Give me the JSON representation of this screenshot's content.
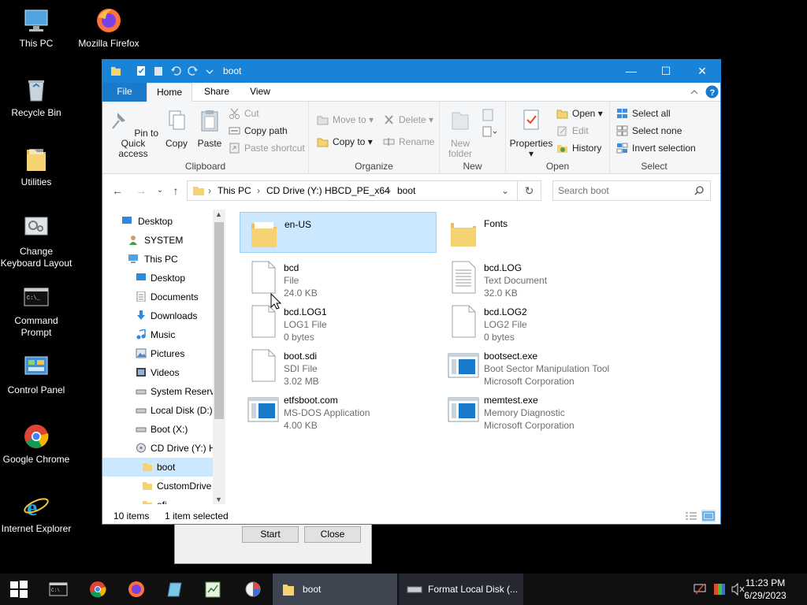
{
  "desktop": {
    "icons": [
      {
        "label": "This PC"
      },
      {
        "label": "Mozilla Firefox"
      },
      {
        "label": "Recycle Bin"
      },
      {
        "label": "Utilities"
      },
      {
        "label": "Change Keyboard Layout"
      },
      {
        "label": "Command Prompt"
      },
      {
        "label": "Control Panel"
      },
      {
        "label": "Google Chrome"
      },
      {
        "label": "Internet Explorer"
      }
    ]
  },
  "bg_dialog": {
    "start_label": "Start",
    "close_label": "Close"
  },
  "window": {
    "title": "boot",
    "controls": {
      "minimize": "—",
      "maximize": "☐",
      "close": "✕"
    },
    "ribbon_tabs": [
      "File",
      "Home",
      "Share",
      "View"
    ],
    "ribbon": {
      "clipboard": {
        "label": "Clipboard",
        "pin": "Pin to Quick access",
        "copy": "Copy",
        "paste": "Paste",
        "cut": "Cut",
        "copy_path": "Copy path",
        "paste_shortcut": "Paste shortcut"
      },
      "organize": {
        "label": "Organize",
        "move_to": "Move to",
        "copy_to": "Copy to",
        "delete": "Delete",
        "rename": "Rename"
      },
      "new": {
        "label": "New",
        "new_folder": "New folder"
      },
      "open": {
        "label": "Open",
        "properties": "Properties",
        "open": "Open",
        "edit": "Edit",
        "history": "History"
      },
      "select": {
        "label": "Select",
        "select_all": "Select all",
        "select_none": "Select none",
        "invert": "Invert selection"
      }
    },
    "address": {
      "crumbs": [
        "This PC",
        "CD Drive (Y:) HBCD_PE_x64",
        "boot"
      ],
      "search_placeholder": "Search boot"
    },
    "nav_items": [
      {
        "label": "Desktop"
      },
      {
        "label": "SYSTEM"
      },
      {
        "label": "This PC"
      },
      {
        "label": "Desktop"
      },
      {
        "label": "Documents"
      },
      {
        "label": "Downloads"
      },
      {
        "label": "Music"
      },
      {
        "label": "Pictures"
      },
      {
        "label": "Videos"
      },
      {
        "label": "System Reserve"
      },
      {
        "label": "Local Disk (D:)"
      },
      {
        "label": "Boot (X:)"
      },
      {
        "label": "CD Drive (Y:) H"
      },
      {
        "label": "boot"
      },
      {
        "label": "CustomDrive"
      },
      {
        "label": "efi"
      }
    ],
    "files": [
      {
        "name": "en-US",
        "l2": "",
        "l3": ""
      },
      {
        "name": "Fonts",
        "l2": "",
        "l3": ""
      },
      {
        "name": "bcd",
        "l2": "File",
        "l3": "24.0 KB"
      },
      {
        "name": "bcd.LOG",
        "l2": "Text Document",
        "l3": "32.0 KB"
      },
      {
        "name": "bcd.LOG1",
        "l2": "LOG1 File",
        "l3": "0 bytes"
      },
      {
        "name": "bcd.LOG2",
        "l2": "LOG2 File",
        "l3": "0 bytes"
      },
      {
        "name": "boot.sdi",
        "l2": "SDI File",
        "l3": "3.02 MB"
      },
      {
        "name": "bootsect.exe",
        "l2": "Boot Sector Manipulation Tool",
        "l3": "Microsoft Corporation"
      },
      {
        "name": "etfsboot.com",
        "l2": "MS-DOS Application",
        "l3": "4.00 KB"
      },
      {
        "name": "memtest.exe",
        "l2": "Memory Diagnostic",
        "l3": "Microsoft Corporation"
      }
    ],
    "status": {
      "count": "10 items",
      "selected": "1 item selected"
    }
  },
  "taskbar": {
    "tasks": [
      {
        "label": "boot"
      },
      {
        "label": "Format Local Disk (..."
      }
    ],
    "time": "11:23 PM",
    "date": "6/29/2023"
  }
}
